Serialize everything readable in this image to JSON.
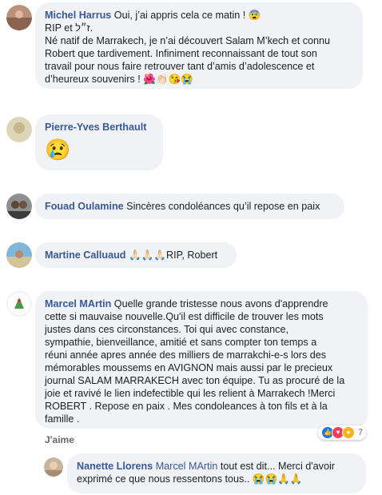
{
  "comments": [
    {
      "name": "Michel Harrus",
      "lines": [
        "Oui, j’ai appris cela ce matin ! 😨",
        "RIP et ז״ל.",
        "Né natif de Marrakech, je n’ai découvert Salam M’kech et connu",
        "Robert que tardivement. Infiniment reconnaissant de tout son",
        "travail pour nous faire retrouver tant d’amis d’adolescence et",
        "d’heureux souvenirs ! 🌺👏🏻😘😭"
      ]
    },
    {
      "name": "Pierre-Yves Berthault",
      "emoji": "😢"
    },
    {
      "name": "Fouad Oulamine",
      "text": "Sincères condoléances qu’il repose en paix"
    },
    {
      "name": "Martine Calluaud",
      "text": "🙏🏻🙏🏻🙏🏻RIP, Robert"
    },
    {
      "name": "Marcel MArtin",
      "lines": [
        "Quelle grande tristesse nous avons d'apprendre",
        "cette si mauvaise nouvelle.Qu'il est difficile de trouver les mots",
        "justes dans ces circonstances. Toi qui avec constance,",
        "sympathie, bienveillance, amitié et sans compter ton temps a",
        "réuni année apres année des milliers de marrakchi-e-s lors des",
        "mémorables moussems en AVIGNON mais aussi par le precieux",
        "journal SALAM MARRAKECH avec ton équipe. Tu as procuré de la",
        "joie et ravivé le lien indefectible qui les relient à Marrakech !Merci",
        "ROBERT . Repose en paix . Mes condoleances à ton fils et à la",
        "famille ."
      ],
      "like_label": "J'aime",
      "reaction_count": "7"
    },
    {
      "name": "Nanette Llorens",
      "mention": "Marcel MArtin",
      "lines": [
        "tout est dit... Merci d'avoir",
        "exprimé ce que nous ressentons tous.. 😭😭🙏🙏"
      ]
    }
  ],
  "colors": {
    "name": "#385898",
    "bubble": "#f0f2f5",
    "meta": "#65676b"
  }
}
